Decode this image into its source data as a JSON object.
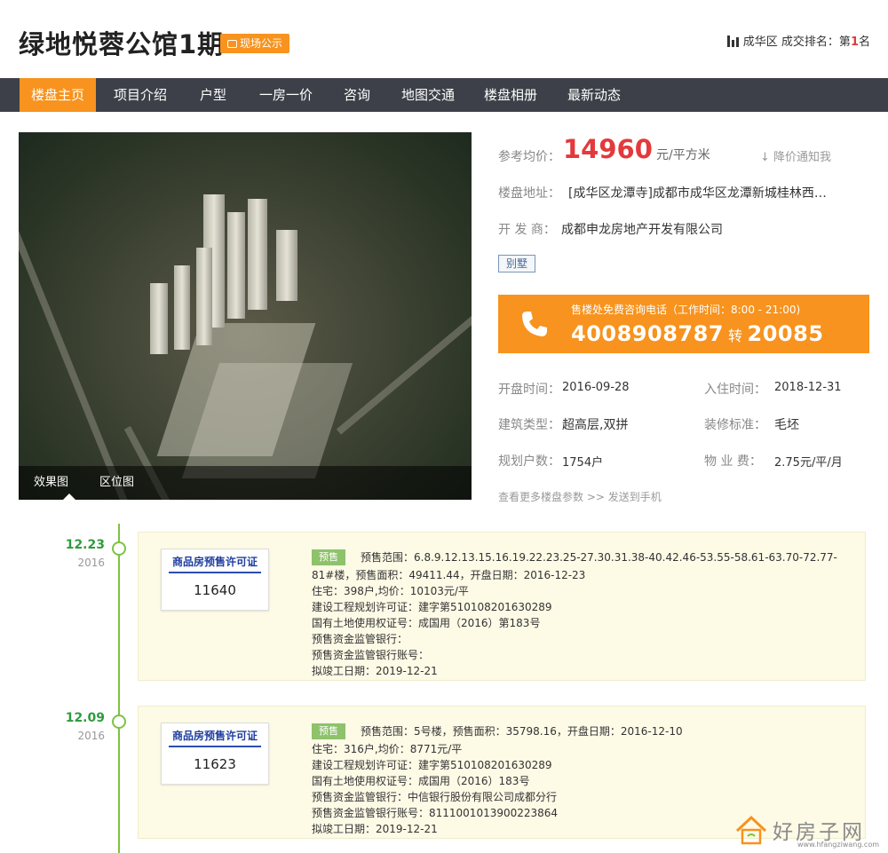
{
  "header": {
    "title": "绿地悦蓉公馆1期",
    "badge": "现场公示",
    "rank_district": "成华区",
    "rank_label": "成交排名：第",
    "rank_value": "1",
    "rank_suffix": "名"
  },
  "nav": {
    "items": [
      "楼盘主页",
      "项目介绍",
      "户型",
      "一房一价",
      "咨询",
      "地图交通",
      "楼盘相册",
      "最新动态"
    ],
    "active": "楼盘主页"
  },
  "photo": {
    "tabs": [
      "效果图",
      "区位图"
    ]
  },
  "info": {
    "price_label": "参考均价：",
    "price": "14960",
    "price_unit": "元/平方米",
    "notify": "降价通知我",
    "address_label": "楼盘地址：",
    "address": "[成华区龙潭寺]成都市成华区龙潭新城桂林西…",
    "developer_label": "开 发 商：",
    "developer": "成都申龙房地产开发有限公司",
    "tag": "别墅",
    "hotline_note": "售楼处免费咨询电话（工作时间：8:00 - 21:00)",
    "hotline_number": "4008908787",
    "hotline_ext_label": "转",
    "hotline_ext": "20085",
    "open_label": "开盘时间：",
    "open_date": "2016-09-28",
    "move_label": "入住时间：",
    "move_date": "2018-12-31",
    "type_label": "建筑类型：",
    "type": "超高层,双拼",
    "deco_label": "装修标准：",
    "deco": "毛坯",
    "units_label": "规划户数：",
    "units": "1754户",
    "fee_label": "物 业 费：",
    "fee": "2.75元/平/月",
    "more": "查看更多楼盘参数 >> 发送到手机"
  },
  "timeline": [
    {
      "date": "12.23",
      "year": "2016",
      "permit_title": "商品房预售许可证",
      "permit_no": "11640",
      "tag": "预售",
      "lines": [
        "预售范围：6.8.9.12.13.15.16.19.22.23.25-27.30.31.38-40.42.46-53.55-58.61-63.70-72.77-",
        "81#楼，预售面积：49411.44，开盘日期：2016-12-23",
        "住宅：398户,均价：10103元/平",
        "建设工程规划许可证：建字第510108201630289",
        "国有土地使用权证号：成国用（2016）第183号",
        "预售资金监管银行：",
        "预售资金监管银行账号：",
        "拟竣工日期：2019-12-21"
      ]
    },
    {
      "date": "12.09",
      "year": "2016",
      "permit_title": "商品房预售许可证",
      "permit_no": "11623",
      "tag": "预售",
      "lines": [
        "预售范围：5号楼，预售面积：35798.16，开盘日期：2016-12-10",
        "住宅：316户,均价：8771元/平",
        "建设工程规划许可证：建字第510108201630289",
        "国有土地使用权证号：成国用（2016）183号",
        "预售资金监管银行：中信银行股份有限公司成都分行",
        "预售资金监管银行账号：8111001013900223864",
        "拟竣工日期：2019-12-21"
      ]
    }
  ],
  "watermark": {
    "text": "好房子网",
    "url": "www.hfangziwang.com"
  },
  "colors": {
    "accent": "#f7931e",
    "nav_bg": "#3d4048",
    "price": "#e4393c",
    "timeline": "#7dc243",
    "card_bg": "#fdfae6"
  }
}
